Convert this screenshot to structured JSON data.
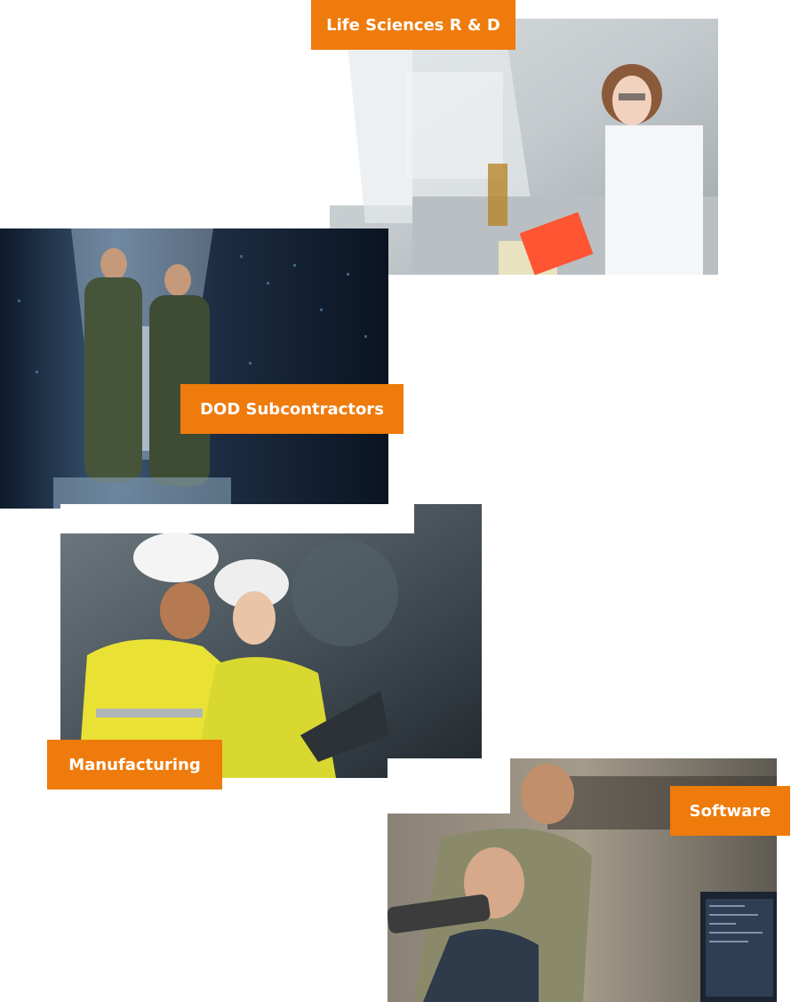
{
  "categories": [
    {
      "key": "life",
      "label": "Life Sciences R & D",
      "photo": "lab-scientist-pipetting-photo"
    },
    {
      "key": "dod",
      "label": "DOD Subcontractors",
      "photo": "soldiers-in-server-room-photo"
    },
    {
      "key": "mfg",
      "label": "Manufacturing",
      "photo": "engineers-with-laptop-photo"
    },
    {
      "key": "soft",
      "label": "Software",
      "photo": "developers-at-monitor-photo"
    }
  ],
  "colors": {
    "accent": "#ee7b0c",
    "label_text": "#ffffff"
  }
}
